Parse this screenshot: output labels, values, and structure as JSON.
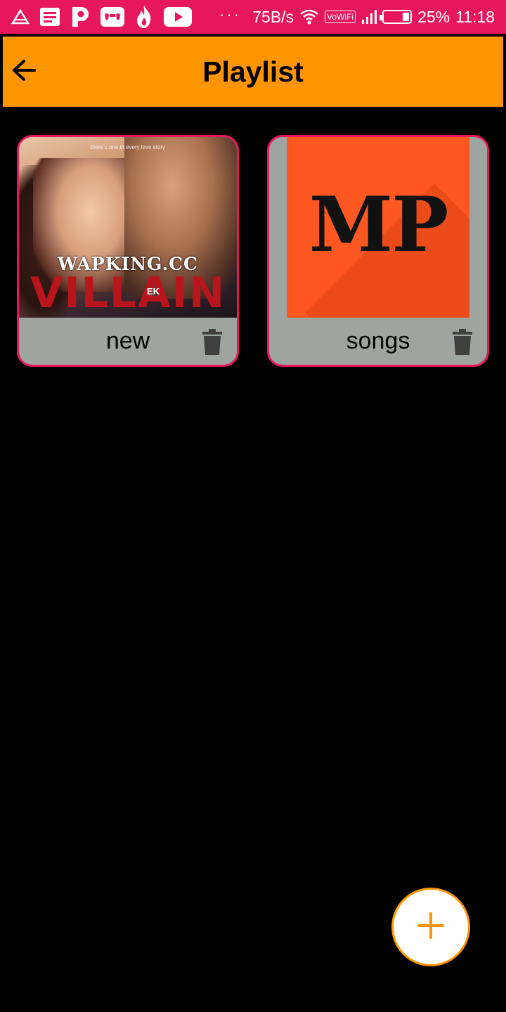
{
  "status_bar": {
    "network_speed": "75B/s",
    "vowifi_label": "VoWiFi",
    "battery": "25%",
    "time": "11:18",
    "overflow_dots": "···",
    "left_icons": [
      "warning-triangle-icon",
      "notes-icon",
      "p-app-icon",
      "gamepad-icon",
      "flame-icon",
      "youtube-icon"
    ]
  },
  "appbar": {
    "title": "Playlist",
    "background_color": "#ff9500"
  },
  "playlists": [
    {
      "name": "new",
      "cover": {
        "watermark": "WAPKING.CC",
        "title": "VILLAIN",
        "prefix": "EK",
        "tagline": "there's one in every love story"
      }
    },
    {
      "name": "songs",
      "cover": {
        "text": "MP"
      }
    }
  ],
  "fab": {
    "icon": "plus-icon"
  },
  "colors": {
    "status_bar": "#e8175d",
    "card_border": "#e8175d",
    "card_footer": "#9ea5a0",
    "mp_cover": "#ff5722",
    "background": "#000000"
  }
}
